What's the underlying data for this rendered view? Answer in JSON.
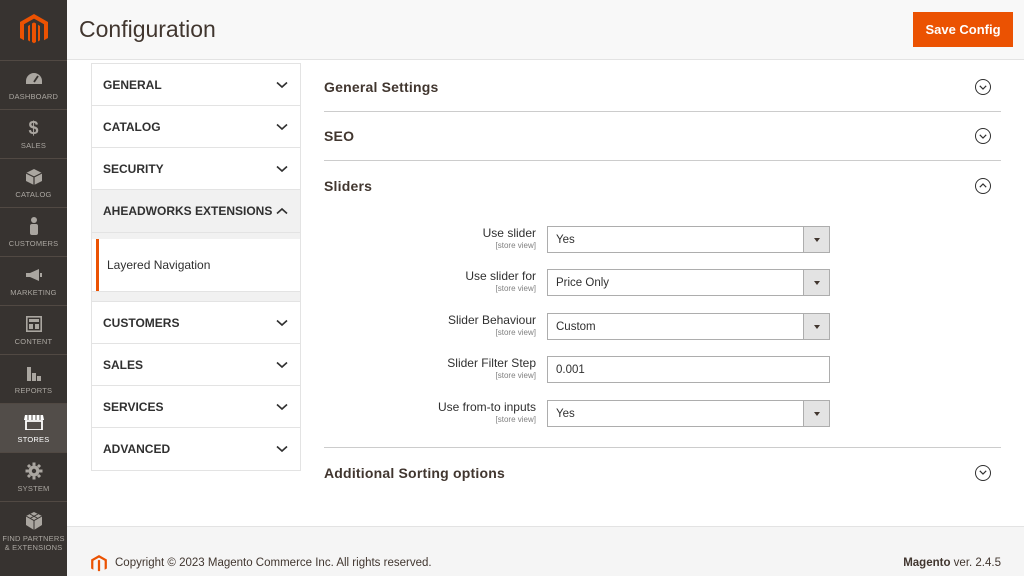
{
  "nav": {
    "items": [
      {
        "label": "DASHBOARD",
        "icon": "speedometer-icon"
      },
      {
        "label": "SALES",
        "icon": "dollar-icon"
      },
      {
        "label": "CATALOG",
        "icon": "box-icon"
      },
      {
        "label": "CUSTOMERS",
        "icon": "person-icon"
      },
      {
        "label": "MARKETING",
        "icon": "megaphone-icon"
      },
      {
        "label": "CONTENT",
        "icon": "layout-icon"
      },
      {
        "label": "REPORTS",
        "icon": "bar-chart-icon"
      },
      {
        "label": "STORES",
        "icon": "storefront-icon"
      },
      {
        "label": "SYSTEM",
        "icon": "gear-icon"
      },
      {
        "label": "FIND PARTNERS & EXTENSIONS",
        "icon": "cubes-icon"
      }
    ],
    "active": "STORES",
    "accent": "#eb5202"
  },
  "header": {
    "title": "Configuration",
    "save_label": "Save Config"
  },
  "tabs": {
    "groups": [
      {
        "label": "GENERAL"
      },
      {
        "label": "CATALOG"
      },
      {
        "label": "SECURITY"
      },
      {
        "label": "AHEADWORKS EXTENSIONS",
        "expanded": true,
        "sub": [
          "Layered Navigation"
        ]
      },
      {
        "label": "CUSTOMERS"
      },
      {
        "label": "SALES"
      },
      {
        "label": "SERVICES"
      },
      {
        "label": "ADVANCED"
      }
    ]
  },
  "sections": {
    "general": {
      "title": "General Settings",
      "expanded": false
    },
    "seo": {
      "title": "SEO",
      "expanded": false
    },
    "sliders": {
      "title": "Sliders",
      "expanded": true
    },
    "sorting": {
      "title": "Additional Sorting options",
      "expanded": false
    }
  },
  "fields": [
    {
      "label": "Use slider",
      "scope": "[store view]",
      "value": "Yes",
      "type": "select"
    },
    {
      "label": "Use slider for",
      "scope": "[store view]",
      "value": "Price Only",
      "type": "select"
    },
    {
      "label": "Slider Behaviour",
      "scope": "[store view]",
      "value": "Custom",
      "type": "select"
    },
    {
      "label": "Slider Filter Step",
      "scope": "[store view]",
      "value": "0.001",
      "type": "text"
    },
    {
      "label": "Use from-to inputs",
      "scope": "[store view]",
      "value": "Yes",
      "type": "select"
    }
  ],
  "footer": {
    "copyright": "Copyright © 2023 Magento Commerce Inc. All rights reserved.",
    "brand": "Magento",
    "version": " ver. 2.4.5"
  }
}
